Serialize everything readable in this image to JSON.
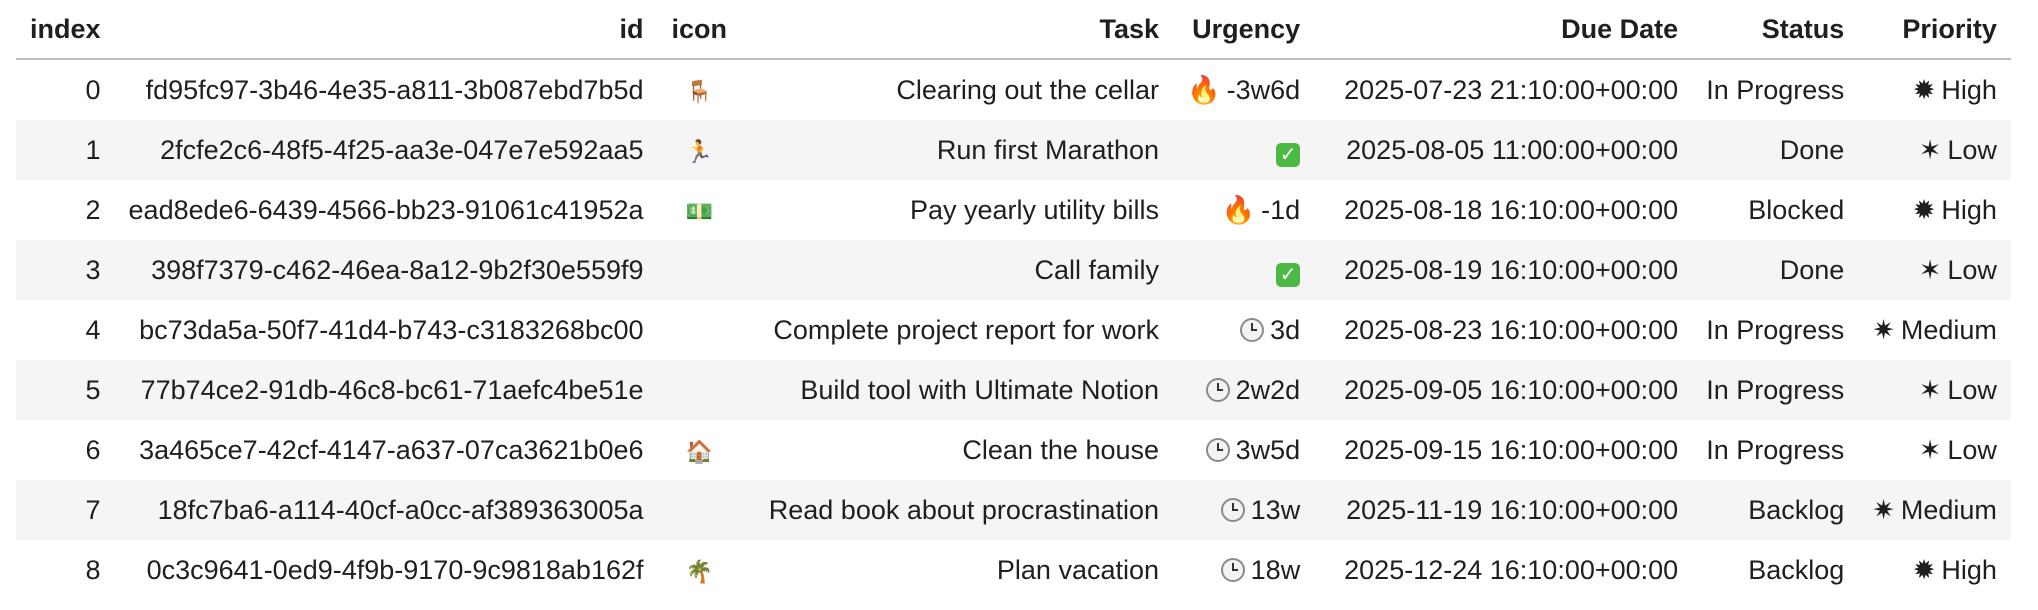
{
  "table": {
    "headers": {
      "index": "index",
      "id": "id",
      "icon": "icon",
      "task": "Task",
      "urgency": "Urgency",
      "due": "Due Date",
      "status": "Status",
      "priority": "Priority"
    },
    "rows": [
      {
        "index": "0",
        "id": "fd95fc97-3b46-4e35-a811-3b087ebd7b5d",
        "icon": "🪑",
        "icon_name": "chair-icon",
        "task": "Clearing out the cellar",
        "urgency_symbol": "🔥",
        "urgency_kind": "fire",
        "urgency": "-3w6d",
        "due": "2025-07-23 21:10:00+00:00",
        "status": "In Progress",
        "priority_symbol": "✹",
        "priority": "High"
      },
      {
        "index": "1",
        "id": "2fcfe2c6-48f5-4f25-aa3e-047e7e592aa5",
        "icon": "🏃",
        "icon_name": "runner-icon",
        "task": "Run first Marathon",
        "urgency_symbol": "✓",
        "urgency_kind": "check",
        "urgency": "",
        "due": "2025-08-05 11:00:00+00:00",
        "status": "Done",
        "priority_symbol": "✶",
        "priority": "Low"
      },
      {
        "index": "2",
        "id": "ead8ede6-6439-4566-bb23-91061c41952a",
        "icon": "💵",
        "icon_name": "money-icon",
        "task": "Pay yearly utility bills",
        "urgency_symbol": "🔥",
        "urgency_kind": "fire",
        "urgency": "-1d",
        "due": "2025-08-18 16:10:00+00:00",
        "status": "Blocked",
        "priority_symbol": "✹",
        "priority": "High"
      },
      {
        "index": "3",
        "id": "398f7379-c462-46ea-8a12-9b2f30e559f9",
        "icon": "",
        "icon_name": "",
        "task": "Call family",
        "urgency_symbol": "✓",
        "urgency_kind": "check",
        "urgency": "",
        "due": "2025-08-19 16:10:00+00:00",
        "status": "Done",
        "priority_symbol": "✶",
        "priority": "Low"
      },
      {
        "index": "4",
        "id": "bc73da5a-50f7-41d4-b743-c3183268bc00",
        "icon": "",
        "icon_name": "",
        "task": "Complete project report for work",
        "urgency_symbol": "",
        "urgency_kind": "clock",
        "urgency": "3d",
        "due": "2025-08-23 16:10:00+00:00",
        "status": "In Progress",
        "priority_symbol": "✷",
        "priority": "Medium"
      },
      {
        "index": "5",
        "id": "77b74ce2-91db-46c8-bc61-71aefc4be51e",
        "icon": "",
        "icon_name": "",
        "task": "Build tool with Ultimate Notion",
        "urgency_symbol": "",
        "urgency_kind": "clock",
        "urgency": "2w2d",
        "due": "2025-09-05 16:10:00+00:00",
        "status": "In Progress",
        "priority_symbol": "✶",
        "priority": "Low"
      },
      {
        "index": "6",
        "id": "3a465ce7-42cf-4147-a637-07ca3621b0e6",
        "icon": "🏠",
        "icon_name": "house-icon",
        "task": "Clean the house",
        "urgency_symbol": "",
        "urgency_kind": "clock",
        "urgency": "3w5d",
        "due": "2025-09-15 16:10:00+00:00",
        "status": "In Progress",
        "priority_symbol": "✶",
        "priority": "Low"
      },
      {
        "index": "7",
        "id": "18fc7ba6-a114-40cf-a0cc-af389363005a",
        "icon": "",
        "icon_name": "",
        "task": "Read book about procrastination",
        "urgency_symbol": "",
        "urgency_kind": "clock",
        "urgency": "13w",
        "due": "2025-11-19 16:10:00+00:00",
        "status": "Backlog",
        "priority_symbol": "✷",
        "priority": "Medium"
      },
      {
        "index": "8",
        "id": "0c3c9641-0ed9-4f9b-9170-9c9818ab162f",
        "icon": "🌴",
        "icon_name": "palm-tree-icon",
        "task": "Plan vacation",
        "urgency_symbol": "",
        "urgency_kind": "clock",
        "urgency": "18w",
        "due": "2025-12-24 16:10:00+00:00",
        "status": "Backlog",
        "priority_symbol": "✹",
        "priority": "High"
      }
    ]
  },
  "colors": {
    "header_border": "#bdbdbd",
    "stripe": "#f5f5f5",
    "done_check": "#4cb944",
    "fire": "#e8590c"
  }
}
